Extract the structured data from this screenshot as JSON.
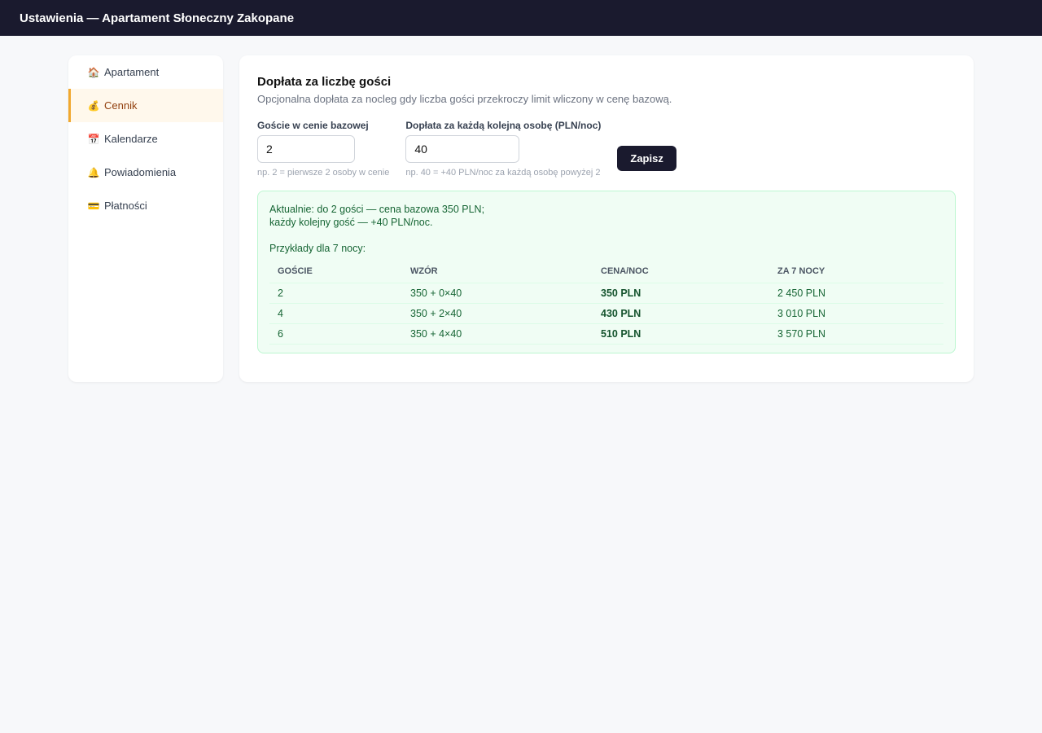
{
  "header": {
    "title": "Ustawienia — Apartament Słoneczny Zakopane"
  },
  "sidebar": {
    "items": [
      {
        "icon": "🏠",
        "label": "Apartament"
      },
      {
        "icon": "💰",
        "label": "Cennik"
      },
      {
        "icon": "📅",
        "label": "Kalendarze"
      },
      {
        "icon": "🔔",
        "label": "Powiadomienia"
      },
      {
        "icon": "💳",
        "label": "Płatności"
      }
    ],
    "active_index": 1
  },
  "main": {
    "title": "Dopłata za liczbę gości",
    "subtitle": "Opcjonalna dopłata za nocleg gdy liczba gości przekroczy limit wliczony w cenę bazową.",
    "fields": {
      "base_guests": {
        "label": "Goście w cenie bazowej",
        "value": "2",
        "hint": "np. 2 = pierwsze 2 osoby w cenie"
      },
      "extra_fee": {
        "label": "Dopłata za każdą kolejną osobę (PLN/noc)",
        "value": "40",
        "hint": "np. 40 = +40 PLN/noc za każdą osobę powyżej 2"
      }
    },
    "save_label": "Zapisz",
    "preview": {
      "line1": "Aktualnie: do 2 gości — cena bazowa 350 PLN;",
      "line2": "każdy kolejny gość — +40 PLN/noc.",
      "examples_label": "Przykłady dla 7 nocy:",
      "columns": [
        "GOŚCIE",
        "WZÓR",
        "CENA/NOC",
        "ZA 7 NOCY"
      ],
      "rows": [
        {
          "guests": "2",
          "formula": "350 + 0×40",
          "per_night": "350 PLN",
          "total": "2 450 PLN"
        },
        {
          "guests": "4",
          "formula": "350 + 2×40",
          "per_night": "430 PLN",
          "total": "3 010 PLN"
        },
        {
          "guests": "6",
          "formula": "350 + 4×40",
          "per_night": "510 PLN",
          "total": "3 570 PLN"
        }
      ]
    }
  }
}
